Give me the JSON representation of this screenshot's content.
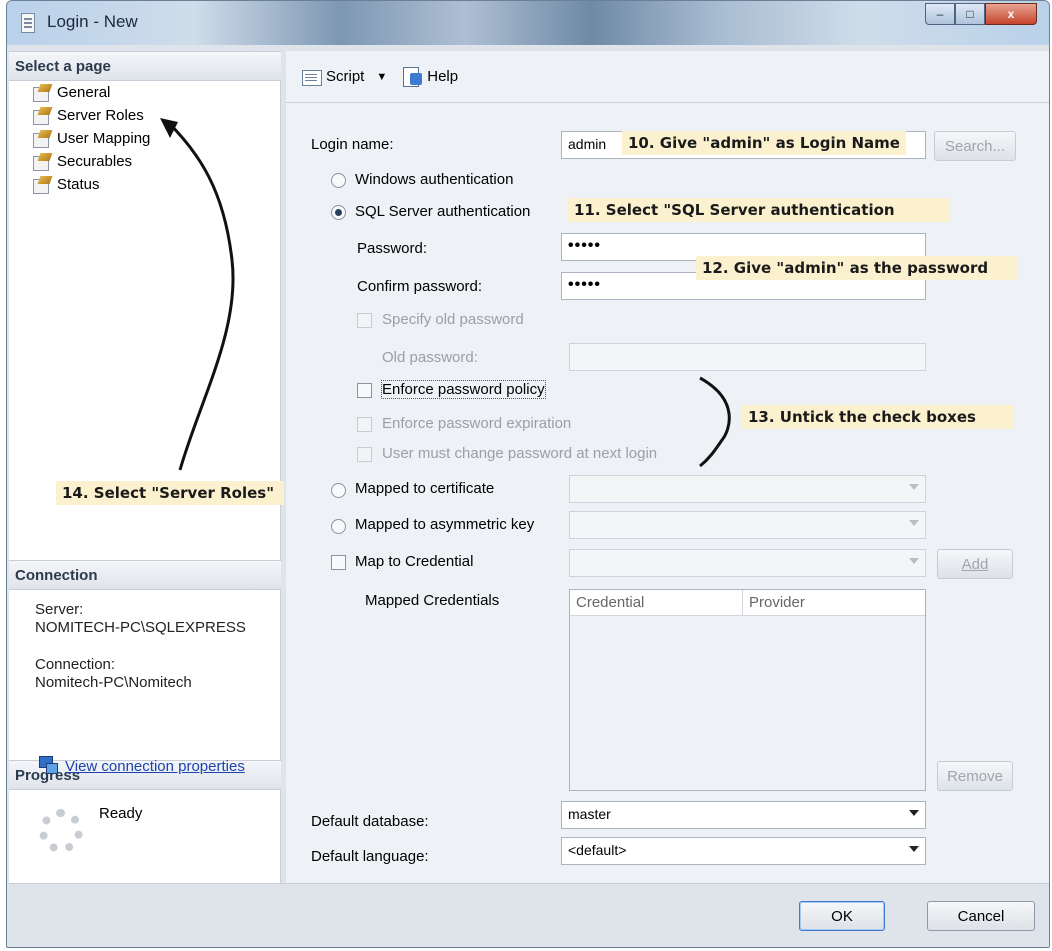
{
  "window": {
    "title": "Login - New",
    "buttons": {
      "minimize": "–",
      "maximize": "□",
      "close": "x"
    }
  },
  "sidebar": {
    "select_page_header": "Select a page",
    "pages": [
      {
        "label": "General",
        "icon": "page-icon"
      },
      {
        "label": "Server Roles",
        "icon": "page-icon"
      },
      {
        "label": "User Mapping",
        "icon": "page-icon"
      },
      {
        "label": "Securables",
        "icon": "page-icon"
      },
      {
        "label": "Status",
        "icon": "page-icon"
      }
    ],
    "connection_header": "Connection",
    "server_label": "Server:",
    "server_value": "NOMITECH-PC\\SQLEXPRESS",
    "connection_label": "Connection:",
    "connection_value": "Nomitech-PC\\Nomitech",
    "view_connection_link": "View connection properties",
    "progress_header": "Progress",
    "progress_status": "Ready"
  },
  "toolbar": {
    "script_label": "Script",
    "help_label": "Help"
  },
  "form": {
    "login_name_label": "Login name:",
    "login_name_value": "admin",
    "search_button": "Search...",
    "windows_auth_label": "Windows authentication",
    "sql_auth_label": "SQL Server authentication",
    "password_label": "Password:",
    "password_value": "•••••",
    "confirm_password_label": "Confirm password:",
    "confirm_password_value": "•••••",
    "specify_old_password_label": "Specify old password",
    "old_password_label": "Old password:",
    "enforce_policy_label": "Enforce password policy",
    "enforce_expiration_label": "Enforce password expiration",
    "must_change_label": "User must change password at next login",
    "mapped_certificate_label": "Mapped to certificate",
    "mapped_asymmetric_label": "Mapped to asymmetric key",
    "map_credential_label": "Map to Credential",
    "add_button": "Add",
    "mapped_credentials_label": "Mapped Credentials",
    "grid_columns": [
      "Credential",
      "Provider"
    ],
    "remove_button": "Remove",
    "default_database_label": "Default database:",
    "default_database_value": "master",
    "default_language_label": "Default language:",
    "default_language_value": "<default>"
  },
  "footer": {
    "ok_button": "OK",
    "cancel_button": "Cancel"
  },
  "annotations": {
    "step10": "10. Give \"admin\" as Login Name",
    "step11": "11. Select \"SQL Server authentication",
    "step12": "12. Give \"admin\" as the password",
    "step13": "13. Untick the check boxes",
    "step14": "14. Select \"Server Roles\""
  }
}
